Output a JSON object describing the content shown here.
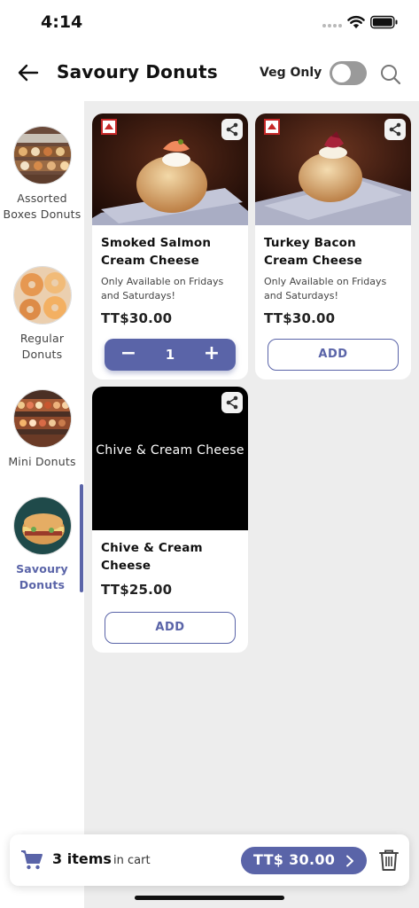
{
  "status_bar": {
    "time": "4:14"
  },
  "header": {
    "title": "Savoury Donuts",
    "veg_only_label": "Veg Only",
    "veg_only_on": false
  },
  "sidebar": {
    "items": [
      {
        "label": "Assorted Boxes Donuts",
        "active": false
      },
      {
        "label": "Regular Donuts",
        "active": false
      },
      {
        "label": "Mini Donuts",
        "active": false
      },
      {
        "label": "Savoury Donuts",
        "active": true
      }
    ]
  },
  "products": [
    {
      "name": "Smoked Salmon Cream Cheese",
      "note": "Only Available on Fridays and Saturdays!",
      "price": "TT$30.00",
      "non_veg": true,
      "in_cart": true,
      "quantity": "1",
      "minus": "−",
      "plus": "+"
    },
    {
      "name": "Turkey Bacon Cream Cheese",
      "note": "Only Available on Fridays and Saturdays!",
      "price": "TT$30.00",
      "non_veg": true,
      "in_cart": false,
      "add_label": "ADD"
    },
    {
      "name": "Chive & Cream Cheese",
      "photo_placeholder": "Chive & Cream Cheese",
      "price": "TT$25.00",
      "non_veg": false,
      "in_cart": false,
      "add_label": "ADD"
    }
  ],
  "cart": {
    "count_text": "3 items",
    "suffix": "in cart",
    "total": "TT$ 30.00"
  },
  "colors": {
    "accent": "#5a64a8",
    "non_veg": "#c62828",
    "panel_bg": "#ededed"
  },
  "icons": [
    "back-arrow-icon",
    "search-icon",
    "share-icon",
    "non-veg-icon",
    "cart-icon",
    "chevron-right-icon",
    "trash-icon"
  ]
}
